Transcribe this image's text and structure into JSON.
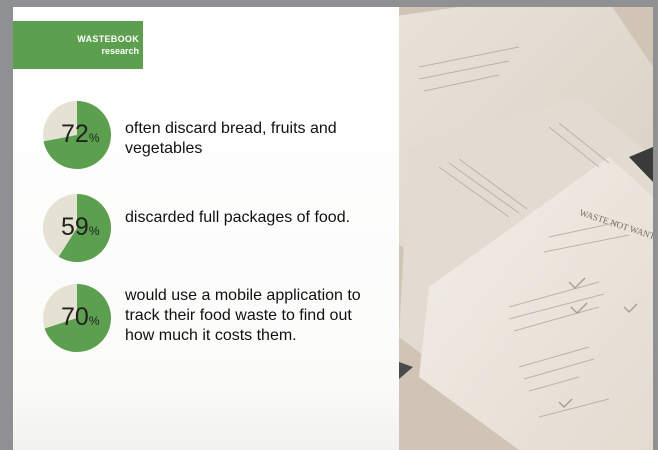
{
  "badge": {
    "line1": "WASTEBOOK",
    "line2": "research"
  },
  "stats": [
    {
      "number": "72",
      "unit": "%",
      "value": 0.72,
      "text": "often discard bread, fruits and vegetables"
    },
    {
      "number": "59",
      "unit": "%",
      "value": 0.59,
      "text": "discarded full packages of food."
    },
    {
      "number": "70",
      "unit": "%",
      "value": 0.7,
      "text": "would use a mobile application to track their food waste to find out how much it costs them."
    }
  ],
  "photo": {
    "heading": "WASTE NOT WANT"
  },
  "colors": {
    "green": "#5c9f4e",
    "pie_rest": "#e6e2d3",
    "background": "#8f9092"
  }
}
